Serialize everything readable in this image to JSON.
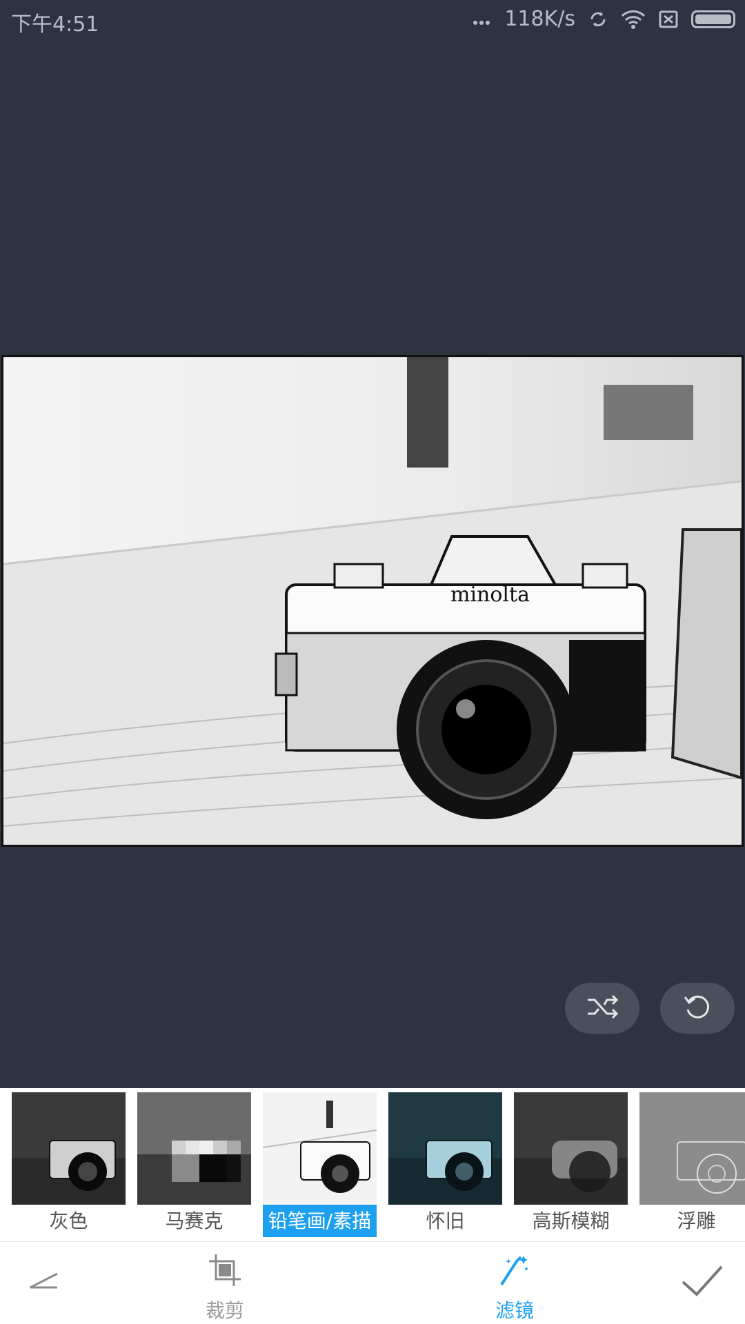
{
  "status_bar": {
    "time": "下午4:51",
    "network_speed": "118K/s",
    "icons": [
      "more-dots-icon",
      "sync-icon",
      "wifi-icon",
      "no-sim-icon",
      "battery-icon"
    ]
  },
  "actions": {
    "shuffle_icon": "shuffle-icon",
    "reset_icon": "rotate-ccw-icon"
  },
  "filters": [
    {
      "label": "灰色",
      "selected": false
    },
    {
      "label": "马赛克",
      "selected": false
    },
    {
      "label": "铅笔画/素描",
      "selected": true
    },
    {
      "label": "怀旧",
      "selected": false
    },
    {
      "label": "高斯模糊",
      "selected": false
    },
    {
      "label": "浮雕",
      "selected": false
    }
  ],
  "toolbar": {
    "back_icon": "back-icon",
    "crop_label": "裁剪",
    "filter_label": "滤镜",
    "confirm_icon": "check-icon"
  },
  "colors": {
    "background": "#2f3340",
    "accent": "#1ea0f0"
  }
}
